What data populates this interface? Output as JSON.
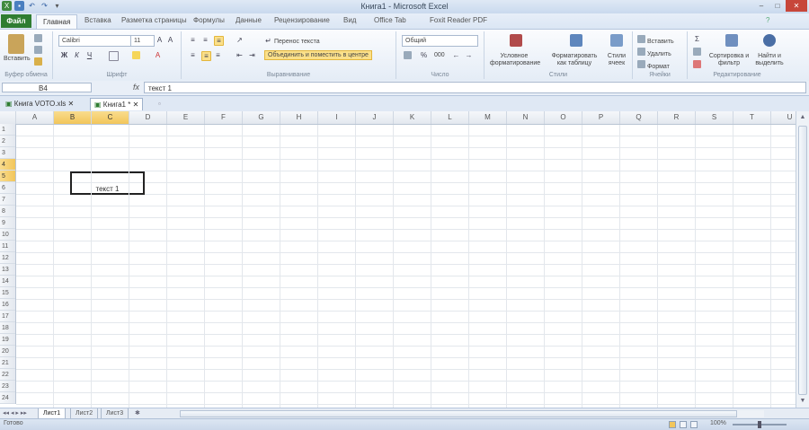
{
  "window": {
    "title": "Книга1 - Microsoft Excel"
  },
  "ribbon_tabs": [
    "Файл",
    "Главная",
    "Вставка",
    "Разметка страницы",
    "Формулы",
    "Данные",
    "Рецензирование",
    "Вид",
    "Office Tab",
    "Foxit Reader PDF"
  ],
  "home": {
    "paste_label": "Вставить",
    "font_name": "Calibri",
    "font_size": "11",
    "wrap_text": "Перенос текста",
    "merge_center": "Объединить и поместить в центре",
    "number_format": "Общий",
    "percent": "%",
    "thousands": "000",
    "cond_format": "Условное форматирование",
    "format_table": "Форматировать как таблицу",
    "cell_styles": "Стили ячеек",
    "insert": "Вставить",
    "delete": "Удалить",
    "format": "Формат",
    "sort_filter": "Сортировка и фильтр",
    "find_select": "Найти и выделить",
    "groups": {
      "clipboard": "Буфер обмена",
      "font": "Шрифт",
      "alignment": "Выравнивание",
      "number": "Число",
      "styles": "Стили",
      "cells": "Ячейки",
      "editing": "Редактирование"
    },
    "bold": "Ж",
    "italic": "К",
    "underline": "Ч"
  },
  "formula_bar": {
    "name_box": "B4",
    "fx": "fx",
    "value": "текст 1"
  },
  "doc_tabs": [
    {
      "label": "Книга VOTO.xls",
      "active": false
    },
    {
      "label": "Книга1 *",
      "active": true
    }
  ],
  "columns": [
    "A",
    "B",
    "C",
    "D",
    "E",
    "F",
    "G",
    "H",
    "I",
    "J",
    "K",
    "L",
    "M",
    "N",
    "O",
    "P",
    "Q",
    "R",
    "S",
    "T",
    "U"
  ],
  "rows": [
    "1",
    "2",
    "3",
    "4",
    "5",
    "6",
    "7",
    "8",
    "9",
    "10",
    "11",
    "12",
    "13",
    "14",
    "15",
    "16",
    "17",
    "18",
    "19",
    "20",
    "21",
    "22",
    "23",
    "24"
  ],
  "active_cell": {
    "text": "текст 1"
  },
  "sheets": [
    {
      "label": "Лист1",
      "active": true
    },
    {
      "label": "Лист2",
      "active": false
    },
    {
      "label": "Лист3",
      "active": false
    }
  ],
  "status": {
    "mode": "Готово",
    "zoom": "100%"
  },
  "colors": {
    "file_tab": "#2f7d32",
    "selected_header": "#f2c65a",
    "active_border": "#222222"
  }
}
